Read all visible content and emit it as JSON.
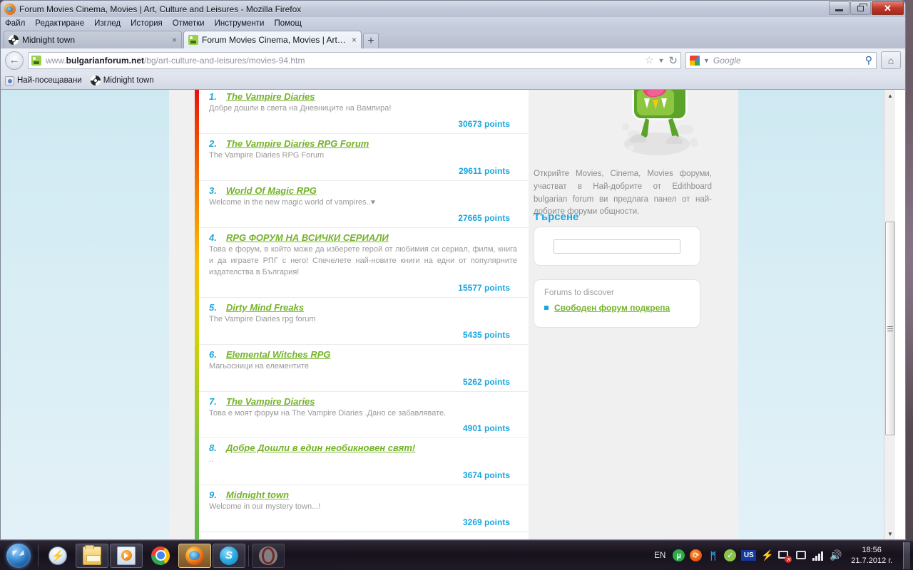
{
  "window": {
    "title": "Forum Movies Cinema, Movies | Art, Culture and Leisures - Mozilla Firefox",
    "minimize_label": "–",
    "restore_label": "❐",
    "close_label": "✕"
  },
  "menubar": {
    "items": [
      {
        "label": "Файл"
      },
      {
        "label": "Редактиране"
      },
      {
        "label": "Изглед"
      },
      {
        "label": "История"
      },
      {
        "label": "Отметки"
      },
      {
        "label": "Инструменти"
      },
      {
        "label": "Помощ"
      }
    ]
  },
  "tabs": [
    {
      "title": "Midnight town",
      "close": "×",
      "favicon": "spiral-icon",
      "active": false
    },
    {
      "title": "Forum Movies Cinema, Movies | Art, ...",
      "close": "×",
      "favicon": "monster-icon",
      "active": true
    }
  ],
  "newtab_label": "+",
  "navbar": {
    "back_label": "←",
    "url_prefix": "www.",
    "url_domain": "bulgarianforum.net",
    "url_path": "/bg/art-culture-and-leisures/movies-94.htm",
    "star_label": "☆",
    "dropdown_label": "▼",
    "reload_label": "↻",
    "search_engine": "Google",
    "search_placeholder": "Google",
    "search_dropdown": "▼",
    "search_go_label": "⚲",
    "home_label": "⌂"
  },
  "bookmarks": [
    {
      "label": "Най-посещавани",
      "icon": "most-visited-icon"
    },
    {
      "label": "Midnight town",
      "icon": "spiral-icon"
    }
  ],
  "forums": [
    {
      "rank": "1.",
      "title": "The Vampire Diaries",
      "description": "Добре дошли в света на Дневниците на Вампира!",
      "points": "30673 points"
    },
    {
      "rank": "2.",
      "title": "The Vampire Diaries RPG Forum",
      "description": "The Vampire Diaries RPG Forum",
      "points": "29611 points"
    },
    {
      "rank": "3.",
      "title": "World Of Magic RPG",
      "description": "Welcome in the new magic world of vampires..♥",
      "points": "27665 points"
    },
    {
      "rank": "4.",
      "title": "RPG ФОРУМ НА ВСИЧКИ СЕРИАЛИ",
      "description": "Това е форум, в който може да изберете герой от любимия си сериал, филм, книга и да играете РПГ с него! Спечелете най-новите книги на едни от популярните издателства в България!",
      "points": "15577 points"
    },
    {
      "rank": "5.",
      "title": "Dirty Mind Freaks",
      "description": "The Vampire Diaries rpg forum",
      "points": "5435 points"
    },
    {
      "rank": "6.",
      "title": "Elemental Witches RPG",
      "description": "Магьосници на елементите",
      "points": "5262 points"
    },
    {
      "rank": "7.",
      "title": "The Vampire Diaries",
      "description": "Това е моят форум на The Vampire Diaries .Дано се забавлявате.",
      "points": "4901 points"
    },
    {
      "rank": "8.",
      "title": "Добре Дошли в един необикновен свят!",
      "description": "..",
      "points": "3674 points"
    },
    {
      "rank": "9.",
      "title": "Midnight town",
      "description": "Welcome in our mystery town...!",
      "points": "3269 points"
    }
  ],
  "sidebar": {
    "mascot_icon": "green-monster-mascot",
    "intro": "Открийте Movies, Cinema, Movies форуми, участват в Най-добрите от Edithboard bulgarian forum ви предлага панел от най-добрите форуми общности.",
    "search_heading": "Търсене",
    "search_value": "",
    "search_placeholder": "",
    "discover_title": "Forums to discover",
    "discover_link": "Свободен форум подкрепа"
  },
  "colors": {
    "link_green": "#74b329",
    "points_blue": "#1aa7e0",
    "rank_blue": "#1fa5dd",
    "page_bg": "#d7ecf4"
  },
  "taskbar": {
    "start_label": "Start",
    "items": [
      {
        "name": "speedfan-icon",
        "label": "⚡"
      },
      {
        "name": "file-explorer-icon",
        "label": ""
      },
      {
        "name": "media-player-icon",
        "label": ""
      },
      {
        "name": "chrome-icon",
        "label": ""
      },
      {
        "name": "firefox-icon",
        "label": ""
      },
      {
        "name": "skype-icon",
        "label": "S"
      },
      {
        "name": "opera-icon",
        "label": ""
      }
    ],
    "tray": {
      "language": "EN",
      "icons": [
        {
          "name": "utorrent-icon",
          "glyph": "µ"
        },
        {
          "name": "reload-orange-icon",
          "glyph": "⟳"
        },
        {
          "name": "bluetooth-icon",
          "glyph": "ᛗ"
        },
        {
          "name": "antivirus-shield-icon",
          "glyph": "✓"
        },
        {
          "name": "keyboard-layout-icon",
          "glyph": "US"
        },
        {
          "name": "flash-icon",
          "glyph": "⚡"
        },
        {
          "name": "network-error-icon",
          "glyph": "✕"
        },
        {
          "name": "safely-remove-icon",
          "glyph": ""
        },
        {
          "name": "signal-strength-icon",
          "glyph": ""
        },
        {
          "name": "volume-icon",
          "glyph": "🔊"
        }
      ],
      "time": "18:56",
      "date": "21.7.2012 г."
    }
  }
}
